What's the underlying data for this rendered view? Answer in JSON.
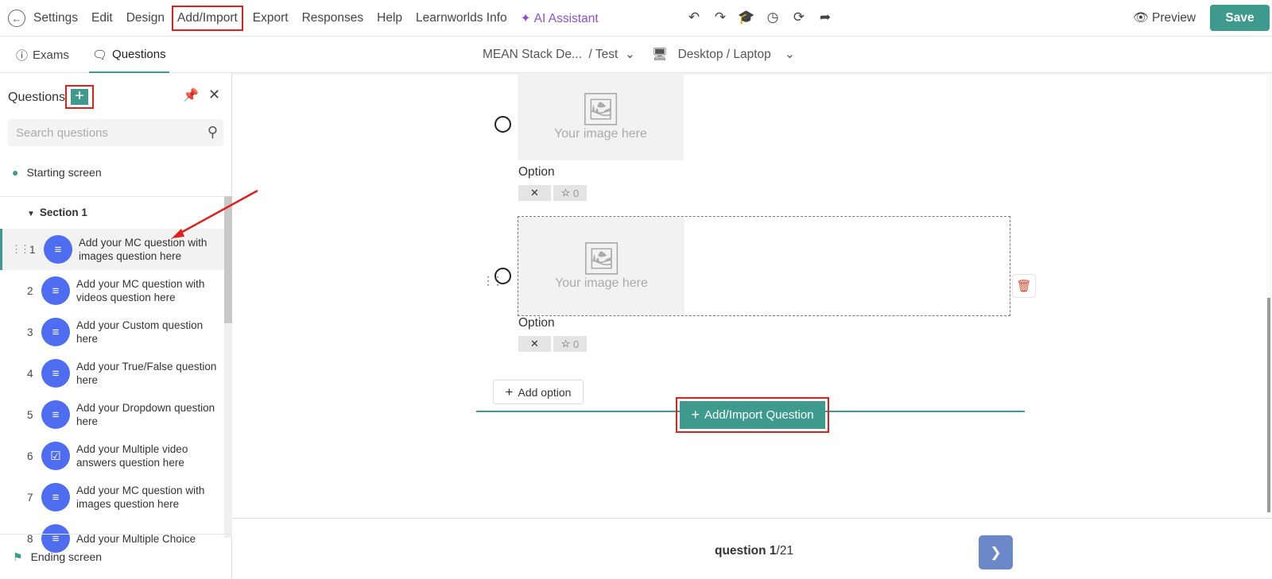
{
  "topbar": {
    "menu": [
      "Settings",
      "Edit",
      "Design",
      "Add/Import",
      "Export",
      "Responses",
      "Help",
      "Learnworlds Info",
      "AI Assistant"
    ],
    "preview_label": "Preview",
    "save_label": "Save"
  },
  "tabs": {
    "exams": "Exams",
    "questions": "Questions",
    "breadcrumb_course": "MEAN Stack De...",
    "breadcrumb_page": "/ Test",
    "device": "Desktop / Laptop"
  },
  "sidebar": {
    "title": "Questions",
    "search_placeholder": "Search questions",
    "starting_screen": "Starting screen",
    "section": "Section 1",
    "ending_screen": "Ending screen",
    "questions": [
      {
        "num": "1",
        "text": "Add your MC question with images question here",
        "icon": "list-icon"
      },
      {
        "num": "2",
        "text": "Add your MC question with videos question here",
        "icon": "list-icon"
      },
      {
        "num": "3",
        "text": "Add your Custom question here",
        "icon": "list-icon"
      },
      {
        "num": "4",
        "text": "Add your True/False question here",
        "icon": "list-icon"
      },
      {
        "num": "5",
        "text": "Add your Dropdown question here",
        "icon": "list-icon"
      },
      {
        "num": "6",
        "text": "Add your Multiple video answers question here",
        "icon": "check-icon"
      },
      {
        "num": "7",
        "text": "Add your MC question with images question here",
        "icon": "list-icon"
      },
      {
        "num": "8",
        "text": "Add your Multiple Choice",
        "icon": "list-icon"
      }
    ]
  },
  "editor": {
    "image_placeholder": "Your image here",
    "options": [
      {
        "label": "Option",
        "score": "0"
      },
      {
        "label": "Option",
        "score": "0"
      }
    ],
    "add_option": "Add option",
    "add_import_question": "Add/Import Question"
  },
  "footer": {
    "question_word": "question",
    "current": "1",
    "total": "/21"
  }
}
